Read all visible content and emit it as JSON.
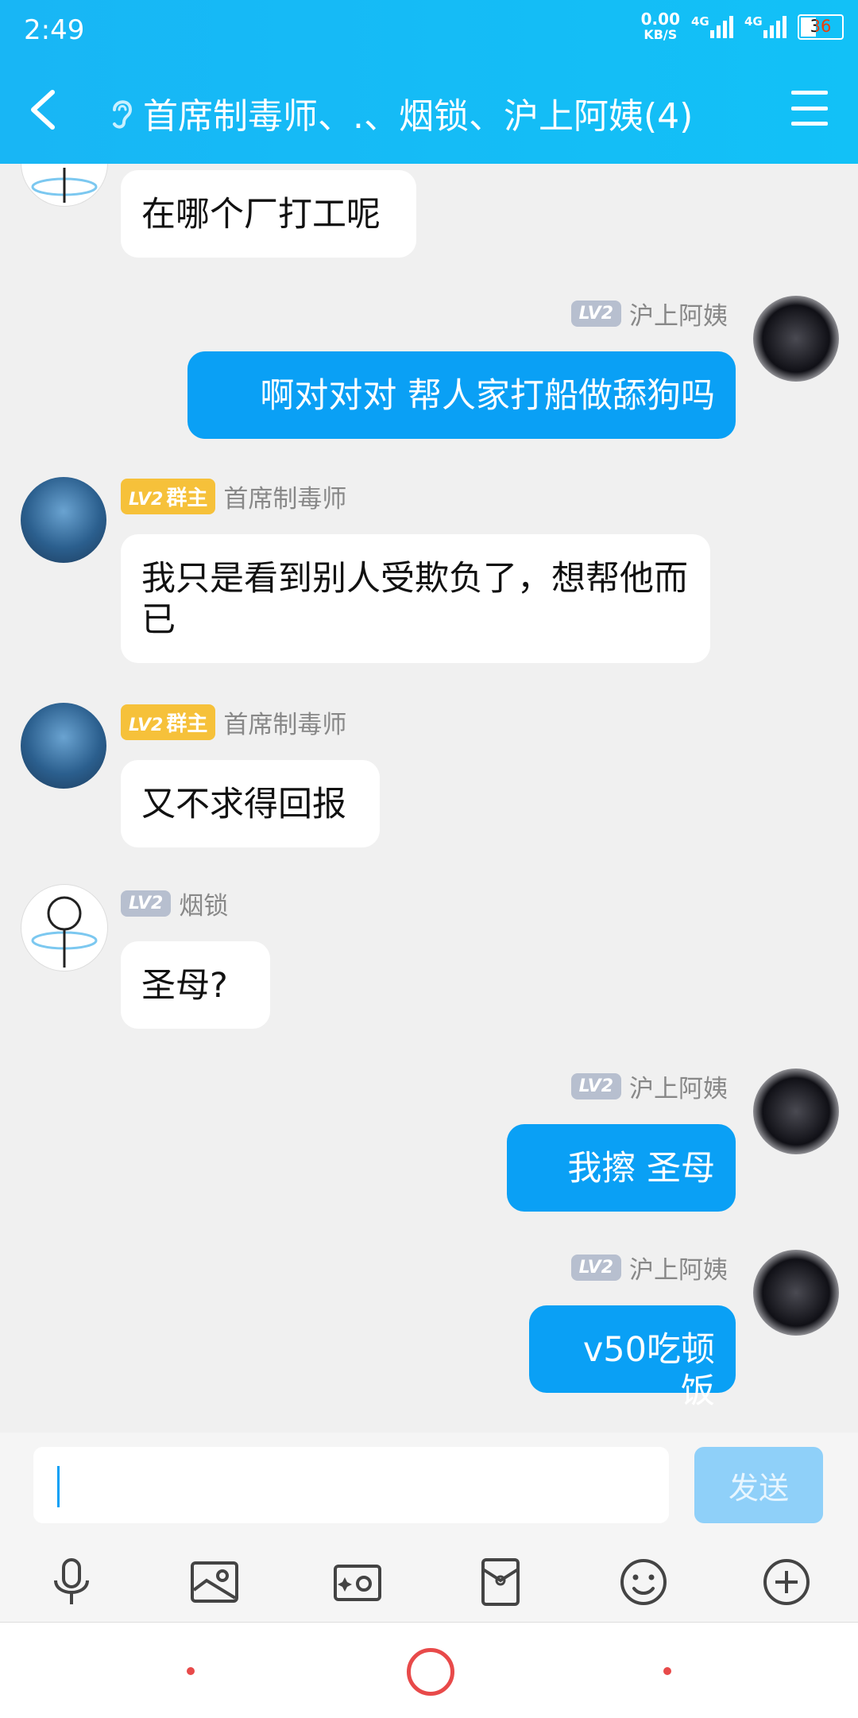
{
  "status": {
    "time": "2:49",
    "net_speed": "0.00",
    "net_unit": "KB/S",
    "sig1": "4G",
    "sig2": "4G",
    "battery": "36"
  },
  "header": {
    "title": "首席制毒师、.、烟锁、沪上阿姨(4)"
  },
  "messages": {
    "m0": {
      "text": "在哪个厂打工呢"
    },
    "m1": {
      "level": "LV2",
      "sender": "沪上阿姨",
      "text": "啊对对对  帮人家打船做舔狗吗"
    },
    "m2": {
      "level": "LV2",
      "badge": "群主",
      "sender": "首席制毒师",
      "text": "我只是看到别人受欺负了，想帮他而已"
    },
    "m3": {
      "level": "LV2",
      "badge": "群主",
      "sender": "首席制毒师",
      "text": "又不求得回报"
    },
    "m4": {
      "level": "LV2",
      "sender": "烟锁",
      "text": "圣母?"
    },
    "m5": {
      "level": "LV2",
      "sender": "沪上阿姨",
      "text": "我擦 圣母"
    },
    "m6": {
      "level": "LV2",
      "sender": "沪上阿姨",
      "text": "v50吃顿饭"
    }
  },
  "input": {
    "value": "",
    "send_label": "发送"
  },
  "toolbar": {
    "icons": [
      "mic-icon",
      "image-icon",
      "camera-icon",
      "red-packet-icon",
      "emoji-icon",
      "plus-icon"
    ]
  },
  "colors": {
    "header": "#18b6f5",
    "bubble_self": "#0aa0f5",
    "send_disabled": "#8fd0f9",
    "owner_badge": "#f6c13a"
  }
}
